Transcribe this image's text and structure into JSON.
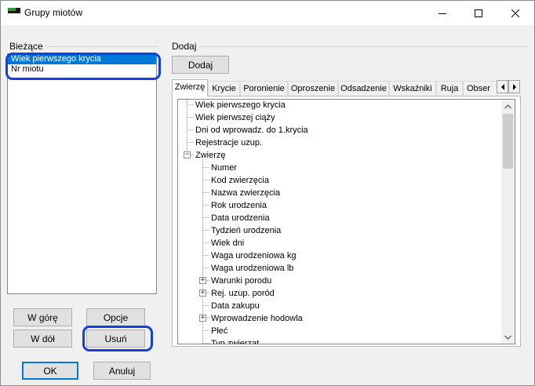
{
  "window": {
    "title": "Grupy miotów"
  },
  "current_group": {
    "label": "Bieżące",
    "items": [
      {
        "label": "Wiek pierwszego krycia",
        "selected": true
      },
      {
        "label": "Nr miotu",
        "selected": false
      }
    ]
  },
  "buttons": {
    "move_up": "W górę",
    "options": "Opcje",
    "move_down": "W dół",
    "remove": "Usuń",
    "ok": "OK",
    "cancel": "Anuluj"
  },
  "add_group": {
    "label": "Dodaj",
    "add_button": "Dodaj"
  },
  "tabs": [
    {
      "label": "Zwierzę",
      "active": true
    },
    {
      "label": "Krycie",
      "active": false
    },
    {
      "label": "Poronienie",
      "active": false
    },
    {
      "label": "Oproszenie",
      "active": false
    },
    {
      "label": "Odsadzenie",
      "active": false
    },
    {
      "label": "Wskaźniki",
      "active": false
    },
    {
      "label": "Ruja",
      "active": false
    },
    {
      "label": "Obser",
      "active": false
    }
  ],
  "tree": {
    "root_items": [
      "Wiek pierwszego krycia",
      "Wiek pierwszej ciąży",
      "Dni od wprowadz. do 1.krycia",
      "Rejestracje uzup."
    ],
    "expanded_node": {
      "label": "Zwierzę",
      "expander": "−"
    },
    "children": [
      {
        "label": "Numer",
        "expander": ""
      },
      {
        "label": "Kod zwierzęcia",
        "expander": ""
      },
      {
        "label": "Nazwa zwierzęcia",
        "expander": ""
      },
      {
        "label": "Rok urodzenia",
        "expander": ""
      },
      {
        "label": "Data urodzenia",
        "expander": ""
      },
      {
        "label": "Tydzień urodzenia",
        "expander": ""
      },
      {
        "label": "Wiek dni",
        "expander": ""
      },
      {
        "label": "Waga urodzeniowa kg",
        "expander": ""
      },
      {
        "label": "Waga urodzeniowa lb",
        "expander": ""
      },
      {
        "label": "Warunki porodu",
        "expander": "+"
      },
      {
        "label": "Rej. uzup. poród",
        "expander": "+"
      },
      {
        "label": "Data zakupu",
        "expander": ""
      },
      {
        "label": "Wprowadzenie hodowla",
        "expander": "+"
      },
      {
        "label": "Płeć",
        "expander": ""
      },
      {
        "label": "Typ zwierząt",
        "expander": ""
      }
    ]
  },
  "colors": {
    "selection": "#0078d7",
    "highlight": "#1140e0",
    "accent_green": "#2a9d3a"
  }
}
